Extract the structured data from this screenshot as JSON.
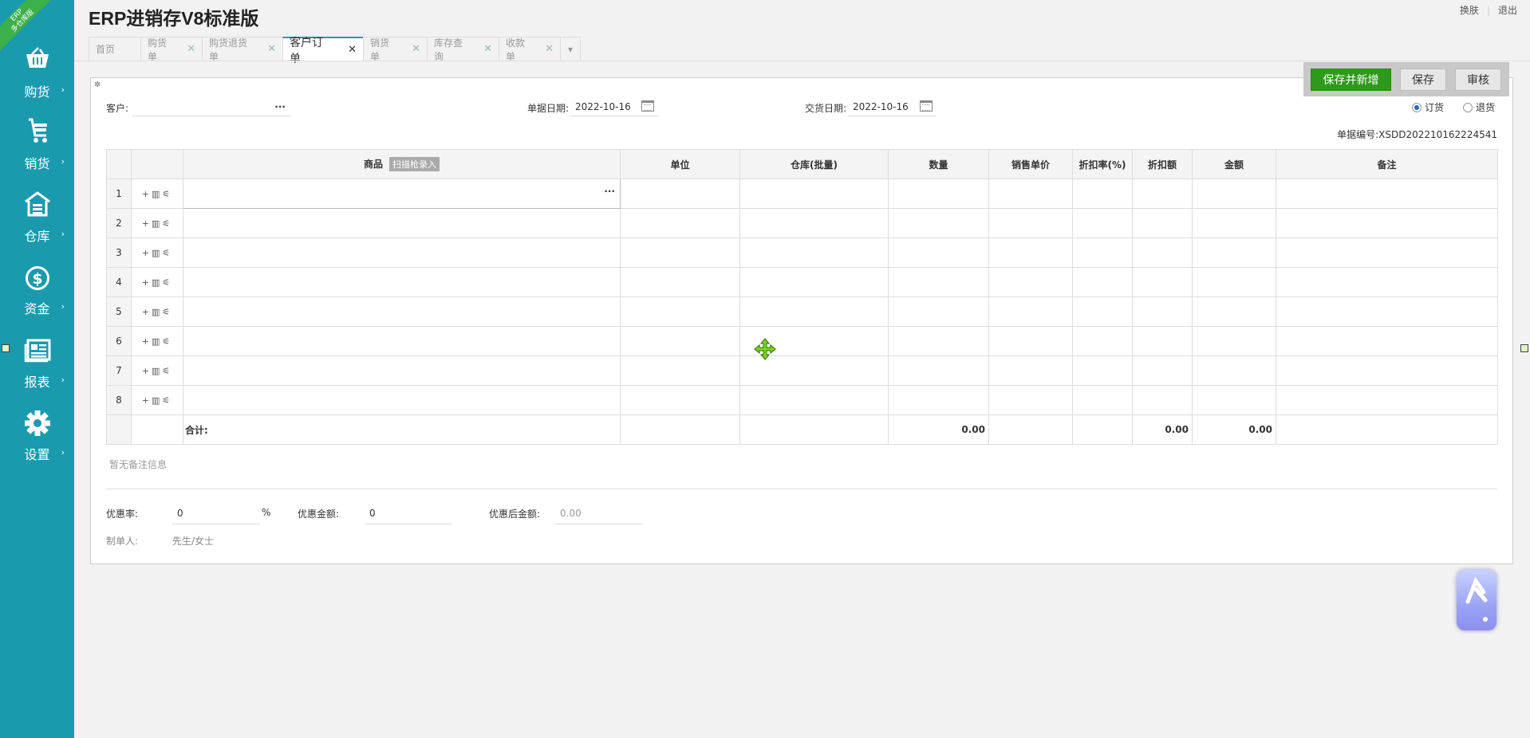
{
  "app": {
    "title": "ERP进销存V8标准版",
    "ribbon_line1": "ERP",
    "ribbon_line2": "多仓库版",
    "top_links": [
      "换肤",
      "退出"
    ]
  },
  "sidebar": {
    "items": [
      {
        "label": "购货",
        "icon": "basket-icon"
      },
      {
        "label": "销货",
        "icon": "cart-icon"
      },
      {
        "label": "仓库",
        "icon": "warehouse-icon"
      },
      {
        "label": "资金",
        "icon": "dollar-icon"
      },
      {
        "label": "报表",
        "icon": "report-icon"
      },
      {
        "label": "设置",
        "icon": "gear-icon"
      }
    ],
    "arrow": "›"
  },
  "tabs": [
    {
      "label": "首页"
    },
    {
      "label": "购货单"
    },
    {
      "label": "购货退货单"
    },
    {
      "label": "客户订单",
      "active": true
    },
    {
      "label": "销货单"
    },
    {
      "label": "库存查询"
    },
    {
      "label": "收款单"
    }
  ],
  "form": {
    "customer_label": "客户:",
    "customer_value": "",
    "customer_dots": "···",
    "doc_date_label": "单据日期:",
    "doc_date": "2022-10-16",
    "delivery_date_label": "交货日期:",
    "delivery_date": "2022-10-16",
    "radio_order": "订货",
    "radio_return": "退货",
    "doc_no": "单据编号:XSDD202210162224541"
  },
  "buttons": {
    "save_new": "保存并新增",
    "save": "保存",
    "audit": "审核"
  },
  "grid": {
    "columns": [
      "商品",
      "单位",
      "仓库(批量)",
      "数量",
      "销售单价",
      "折扣率(%)",
      "折扣额",
      "金额",
      "备注"
    ],
    "scan_badge": "扫描枪录入",
    "row_numbers": [
      "1",
      "2",
      "3",
      "4",
      "5",
      "6",
      "7",
      "8"
    ],
    "row_ops": "+ 🗑 🛒",
    "editing_dots": "···",
    "total_label": "合计:",
    "total_qty": "0.00",
    "total_discount": "0.00",
    "total_amount": "0.00"
  },
  "note": {
    "placeholder": "暂无备注信息"
  },
  "footer": {
    "discount_rate_label": "优惠率:",
    "discount_rate": "0",
    "percent": "%",
    "discount_amount_label": "优惠金额:",
    "discount_amount": "0",
    "after_discount_label": "优惠后金额:",
    "after_discount": "0.00",
    "maker_label": "制单人:",
    "maker": "先生/女士"
  },
  "colors": {
    "sidebar": "#1a9aad",
    "primary_button": "#2e9a1a",
    "ribbon": "#3cb04a"
  }
}
